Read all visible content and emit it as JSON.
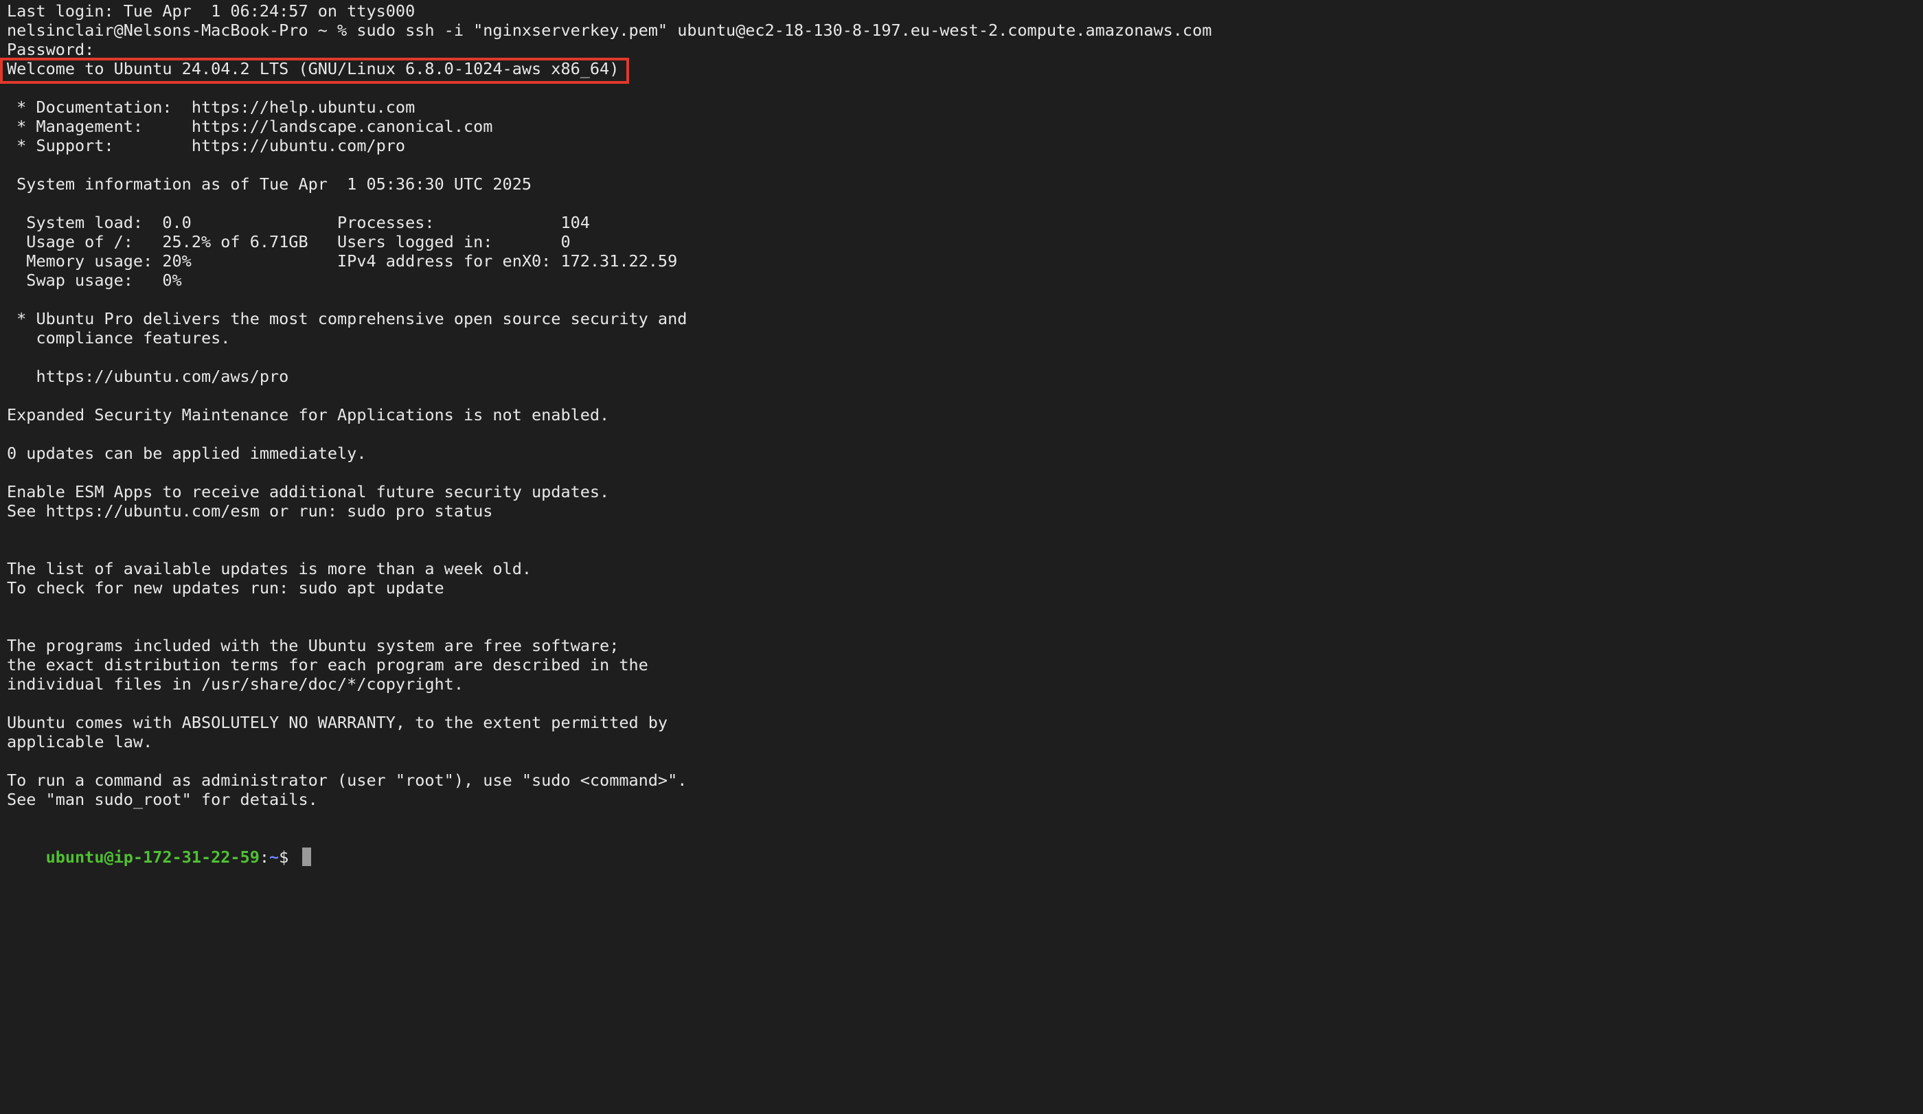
{
  "terminal": {
    "lines": [
      "Last login: Tue Apr  1 06:24:57 on ttys000",
      "nelsinclair@Nelsons-MacBook-Pro ~ % sudo ssh -i \"nginxserverkey.pem\" ubuntu@ec2-18-130-8-197.eu-west-2.compute.amazonaws.com",
      "Password:",
      "Welcome to Ubuntu 24.04.2 LTS (GNU/Linux 6.8.0-1024-aws x86_64)",
      "",
      " * Documentation:  https://help.ubuntu.com",
      " * Management:     https://landscape.canonical.com",
      " * Support:        https://ubuntu.com/pro",
      "",
      " System information as of Tue Apr  1 05:36:30 UTC 2025",
      "",
      "  System load:  0.0               Processes:             104",
      "  Usage of /:   25.2% of 6.71GB   Users logged in:       0",
      "  Memory usage: 20%               IPv4 address for enX0: 172.31.22.59",
      "  Swap usage:   0%",
      "",
      " * Ubuntu Pro delivers the most comprehensive open source security and",
      "   compliance features.",
      "",
      "   https://ubuntu.com/aws/pro",
      "",
      "Expanded Security Maintenance for Applications is not enabled.",
      "",
      "0 updates can be applied immediately.",
      "",
      "Enable ESM Apps to receive additional future security updates.",
      "See https://ubuntu.com/esm or run: sudo pro status",
      "",
      "",
      "The list of available updates is more than a week old.",
      "To check for new updates run: sudo apt update",
      "",
      "",
      "The programs included with the Ubuntu system are free software;",
      "the exact distribution terms for each program are described in the",
      "individual files in /usr/share/doc/*/copyright.",
      "",
      "Ubuntu comes with ABSOLUTELY NO WARRANTY, to the extent permitted by",
      "applicable law.",
      "",
      "To run a command as administrator (user \"root\"), use \"sudo <command>\".",
      "See \"man sudo_root\" for details.",
      ""
    ],
    "prompt": {
      "user_host": "ubuntu@ip-172-31-22-59",
      "colon": ":",
      "path": "~",
      "dollar": "$ "
    }
  },
  "colors": {
    "background": "#1e1e1e",
    "text": "#e8e8e8",
    "highlight_border": "#e0392b",
    "prompt_user": "#4fc132",
    "prompt_path": "#6e86ff"
  }
}
